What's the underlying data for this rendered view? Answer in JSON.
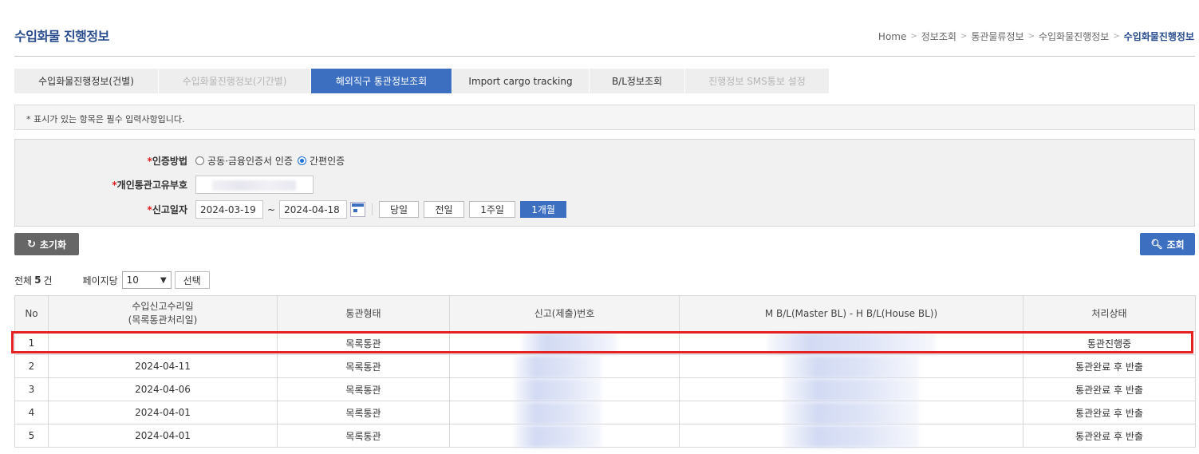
{
  "header": {
    "title": "수입화물 진행정보",
    "breadcrumb": [
      "Home",
      "정보조회",
      "통관물류정보",
      "수입화물진행정보",
      "수입화물진행정보"
    ]
  },
  "tabs": [
    {
      "label": "수입화물진행정보(건별)",
      "state": "normal"
    },
    {
      "label": "수입화물진행정보(기간별)",
      "state": "disabled"
    },
    {
      "label": "해외직구 통관정보조회",
      "state": "active"
    },
    {
      "label": "Import cargo tracking",
      "state": "normal"
    },
    {
      "label": "B/L정보조회",
      "state": "normal"
    },
    {
      "label": "진행정보 SMS통보 설정",
      "state": "disabled"
    }
  ],
  "notice": "* 표시가 있는 항목은 필수 입력사항입니다.",
  "form": {
    "required_mark": "*",
    "auth_label": "인증방법",
    "auth_options": [
      {
        "label": "공동·금융인증서 인증",
        "checked": false
      },
      {
        "label": "간편인증",
        "checked": true
      }
    ],
    "customs_id_label": "개인통관고유부호",
    "date_label": "신고일자",
    "date_from": "2024-03-19",
    "tilde": "~",
    "date_to": "2024-04-18",
    "periods": [
      {
        "label": "당일",
        "active": false
      },
      {
        "label": "전일",
        "active": false
      },
      {
        "label": "1주일",
        "active": false
      },
      {
        "label": "1개월",
        "active": true
      }
    ]
  },
  "actions": {
    "reset_icon": "↻",
    "reset": "초기화",
    "search_icon": "🔍︎",
    "search": "조회"
  },
  "list": {
    "total_prefix": "전체",
    "total_count": "5",
    "total_suffix": "건",
    "page_size_label": "페이지당",
    "page_size": "10",
    "select_button": "선택"
  },
  "table": {
    "headers": [
      "No",
      "수입신고수리일",
      "(목록통관처리일)",
      "통관형태",
      "신고(제출)번호",
      "M B/L(Master BL) - H B/L(House BL))",
      "처리상태"
    ],
    "rows": [
      {
        "no": "1",
        "date": "",
        "type": "목록통관",
        "status": "통관진행중"
      },
      {
        "no": "2",
        "date": "2024-04-11",
        "type": "목록통관",
        "status": "통관완료 후 반출"
      },
      {
        "no": "3",
        "date": "2024-04-06",
        "type": "목록통관",
        "status": "통관완료 후 반출"
      },
      {
        "no": "4",
        "date": "2024-04-01",
        "type": "목록통관",
        "status": "통관완료 후 반출"
      },
      {
        "no": "5",
        "date": "2024-04-01",
        "type": "목록통관",
        "status": "통관완료 후 반출"
      }
    ]
  },
  "colors": {
    "accent": "#3d6fc0",
    "title": "#2a4d8f",
    "highlight": "#e52222",
    "required": "#e02020"
  }
}
